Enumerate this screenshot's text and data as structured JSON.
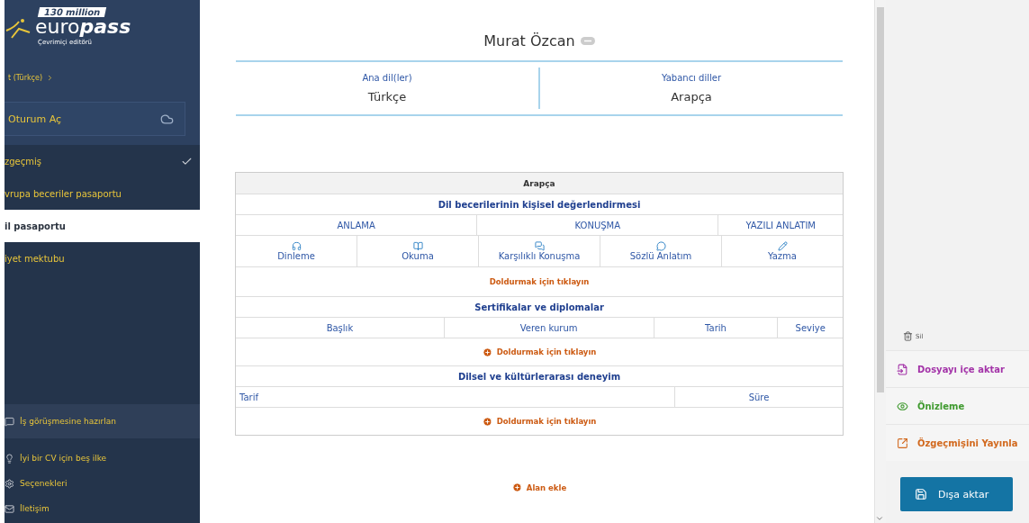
{
  "sidebar": {
    "logo": {
      "badge": "130 million",
      "brand_light": "euro",
      "brand_bold": "pass",
      "subtitle": "Çevrimiçi editörü"
    },
    "language": "t (Türkçe)",
    "login": "Oturum Aç",
    "documents": [
      {
        "label": "zgeçmiş",
        "selected": false,
        "checked": true
      },
      {
        "label": "vrupa beceriler pasaportu",
        "selected": false,
        "checked": false
      },
      {
        "label": "il pasaportu",
        "selected": true,
        "checked": false
      },
      {
        "label": "iyet mektubu",
        "selected": false,
        "checked": false
      }
    ],
    "links": [
      {
        "label": "İş görüşmesine hazırlan",
        "kind": "interview",
        "selected": true
      },
      {
        "label": "İyi bir CV için beş ilke",
        "kind": "tips",
        "selected": false
      },
      {
        "label": "Seçenekleri",
        "kind": "settings",
        "selected": false
      },
      {
        "label": "İletişim",
        "kind": "contact",
        "selected": false
      }
    ]
  },
  "main": {
    "name": "Murat Özcan",
    "languages": [
      {
        "label": "Ana dil(ler)",
        "value": "Türkçe"
      },
      {
        "label": "Yabancı diller",
        "value": "Arapça"
      }
    ],
    "language_table": {
      "title": "Arapça",
      "assessment_title": "Dil becerilerinin kişisel değerlendirmesi",
      "groups": [
        {
          "label": "ANLAMA"
        },
        {
          "label": "KONUŞMA"
        },
        {
          "label": "YAZILI ANLATIM"
        }
      ],
      "skills": [
        {
          "label": "Dinleme",
          "kind": "listening"
        },
        {
          "label": "Okuma",
          "kind": "reading"
        },
        {
          "label": "Karşılıklı Konuşma",
          "kind": "interaction"
        },
        {
          "label": "Sözlü Anlatım",
          "kind": "production"
        },
        {
          "label": "Yazma",
          "kind": "writing"
        }
      ],
      "fill_prompt": "Doldurmak için tıklayın",
      "certificates": {
        "title": "Sertifikalar ve diplomalar",
        "columns": [
          {
            "label": "Başlık"
          },
          {
            "label": "Veren kurum"
          },
          {
            "label": "Tarih"
          },
          {
            "label": "Seviye"
          }
        ],
        "add": "Doldurmak için tıklayın"
      },
      "experience": {
        "title": "Dilsel ve kültürlerarası deneyim",
        "columns": [
          {
            "label": "Tarif"
          },
          {
            "label": "Süre"
          }
        ],
        "add": "Doldurmak için tıklayın"
      }
    },
    "add_section": "Alan ekle"
  },
  "actions": {
    "delete": "Sil",
    "items": [
      {
        "label": "Dosyayı içe aktar",
        "kind": "import",
        "color": "#a333a8"
      },
      {
        "label": "Önizleme",
        "kind": "preview",
        "color": "#3f9a2f"
      },
      {
        "label": "Özgeçmişini Yayınla",
        "kind": "publish",
        "color": "#d2691e"
      }
    ],
    "export": "Dışa aktar"
  }
}
